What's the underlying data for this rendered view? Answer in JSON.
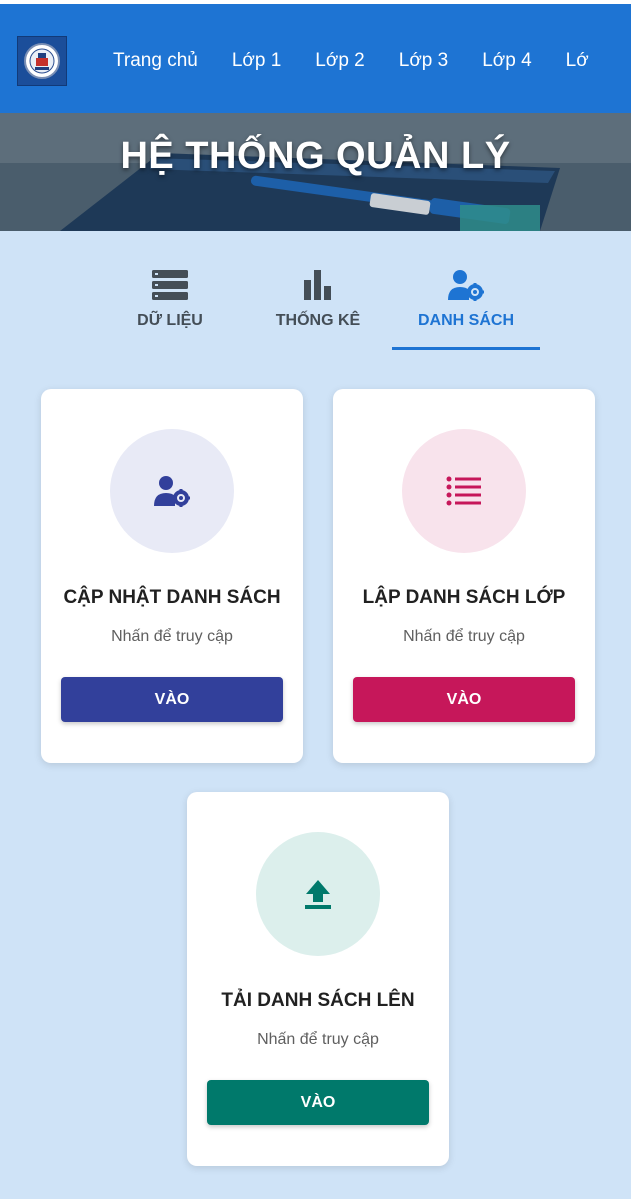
{
  "navbar": {
    "logo_icon": "school-logo-icon",
    "items": [
      "Trang chủ",
      "Lớp 1",
      "Lớp 2",
      "Lớp 3",
      "Lớp 4",
      "Lớ"
    ]
  },
  "hero": {
    "title": "HỆ THỐNG QUẢN LÝ"
  },
  "tabs": [
    {
      "label": "DỮ LIỆU",
      "icon": "database-icon",
      "active": false
    },
    {
      "label": "THỐNG KÊ",
      "icon": "bar-chart-icon",
      "active": false
    },
    {
      "label": "DANH SÁCH",
      "icon": "user-gear-icon",
      "active": true
    }
  ],
  "cards": [
    {
      "title": "CẬP NHẬT DANH SÁCH",
      "subtitle": "Nhấn để truy cập",
      "button": "VÀO",
      "icon": "user-gear-icon",
      "accent": "#32409b",
      "tint": "#e8eaf6"
    },
    {
      "title": "LẬP DANH SÁCH LỚP",
      "subtitle": "Nhấn để truy cập",
      "button": "VÀO",
      "icon": "list-icon",
      "accent": "#c6175a",
      "tint": "#f8e3ec"
    },
    {
      "title": "TẢI DANH SÁCH LÊN",
      "subtitle": "Nhấn để truy cập",
      "button": "VÀO",
      "icon": "upload-icon",
      "accent": "#00796b",
      "tint": "#dcefec"
    }
  ],
  "colors": {
    "primary": "#1e74d3",
    "background": "#cfe3f7"
  }
}
